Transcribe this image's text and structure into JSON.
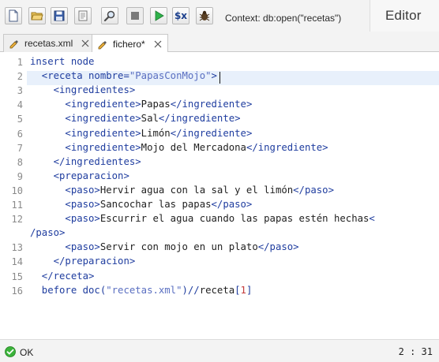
{
  "toolbar": {
    "buttons": [
      {
        "name": "new-file-icon"
      },
      {
        "name": "open-folder-icon"
      },
      {
        "name": "save-icon"
      },
      {
        "name": "document-icon"
      },
      {
        "name": "find-icon"
      },
      {
        "name": "stop-icon"
      },
      {
        "name": "run-icon"
      },
      {
        "name": "variables-icon",
        "label": "$x"
      },
      {
        "name": "debug-bug-icon"
      }
    ],
    "context_label": "Context: db:open(\"recetas\")",
    "panel_title": "Editor"
  },
  "tabs": [
    {
      "label": "recetas.xml",
      "active": false
    },
    {
      "label": "fichero*",
      "active": true
    }
  ],
  "editor": {
    "line_numbers": [
      "1",
      "2",
      "3",
      "4",
      "5",
      "6",
      "7",
      "8",
      "9",
      "10",
      "11",
      "12",
      "",
      "13",
      "14",
      "15",
      "16"
    ],
    "current_line": "2",
    "lines": [
      [
        {
          "t": "insert node",
          "c": "k-kw"
        }
      ],
      [
        {
          "t": "  <receta nombre=",
          "c": "k-br"
        },
        {
          "t": "\"PapasConMojo\"",
          "c": "k-str"
        },
        {
          "t": ">",
          "c": "k-br"
        }
      ],
      [
        {
          "t": "    <ingredientes>",
          "c": "k-br"
        }
      ],
      [
        {
          "t": "      <ingrediente>",
          "c": "k-br"
        },
        {
          "t": "Papas",
          "c": "k-txt"
        },
        {
          "t": "</ingrediente>",
          "c": "k-br"
        }
      ],
      [
        {
          "t": "      <ingrediente>",
          "c": "k-br"
        },
        {
          "t": "Sal",
          "c": "k-txt"
        },
        {
          "t": "</ingrediente>",
          "c": "k-br"
        }
      ],
      [
        {
          "t": "      <ingrediente>",
          "c": "k-br"
        },
        {
          "t": "Limón",
          "c": "k-txt"
        },
        {
          "t": "</ingrediente>",
          "c": "k-br"
        }
      ],
      [
        {
          "t": "      <ingrediente>",
          "c": "k-br"
        },
        {
          "t": "Mojo del Mercadona",
          "c": "k-txt"
        },
        {
          "t": "</ingrediente>",
          "c": "k-br"
        }
      ],
      [
        {
          "t": "    </ingredientes>",
          "c": "k-br"
        }
      ],
      [
        {
          "t": "    <preparacion>",
          "c": "k-br"
        }
      ],
      [
        {
          "t": "      <paso>",
          "c": "k-br"
        },
        {
          "t": "Hervir agua con la sal y el limón",
          "c": "k-txt"
        },
        {
          "t": "</paso>",
          "c": "k-br"
        }
      ],
      [
        {
          "t": "      <paso>",
          "c": "k-br"
        },
        {
          "t": "Sancochar las papas",
          "c": "k-txt"
        },
        {
          "t": "</paso>",
          "c": "k-br"
        }
      ],
      [
        {
          "t": "      <paso>",
          "c": "k-br"
        },
        {
          "t": "Escurrir el agua cuando las papas estén hechas",
          "c": "k-txt"
        },
        {
          "t": "<",
          "c": "k-br"
        }
      ],
      [
        {
          "t": "/paso>",
          "c": "k-br"
        }
      ],
      [
        {
          "t": "      <paso>",
          "c": "k-br"
        },
        {
          "t": "Servir con mojo en un plato",
          "c": "k-txt"
        },
        {
          "t": "</paso>",
          "c": "k-br"
        }
      ],
      [
        {
          "t": "    </preparacion>",
          "c": "k-br"
        }
      ],
      [
        {
          "t": "  </receta>",
          "c": "k-br"
        }
      ],
      [
        {
          "t": "  before doc(",
          "c": "k-kw"
        },
        {
          "t": "\"recetas.xml\"",
          "c": "k-str"
        },
        {
          "t": ")//",
          "c": "k-kw"
        },
        {
          "t": "receta",
          "c": "k-txt"
        },
        {
          "t": "[",
          "c": "k-kw"
        },
        {
          "t": "1",
          "c": "k-num"
        },
        {
          "t": "]",
          "c": "k-kw"
        }
      ]
    ]
  },
  "status": {
    "text": "OK",
    "cursor_position": "2 : 31"
  },
  "colors": {
    "keyword": "#1f3d9f",
    "string": "#5a6fc1",
    "number": "#c43b3b",
    "current_line_bg": "#e8f0fb",
    "ok_green": "#3bb33b"
  }
}
